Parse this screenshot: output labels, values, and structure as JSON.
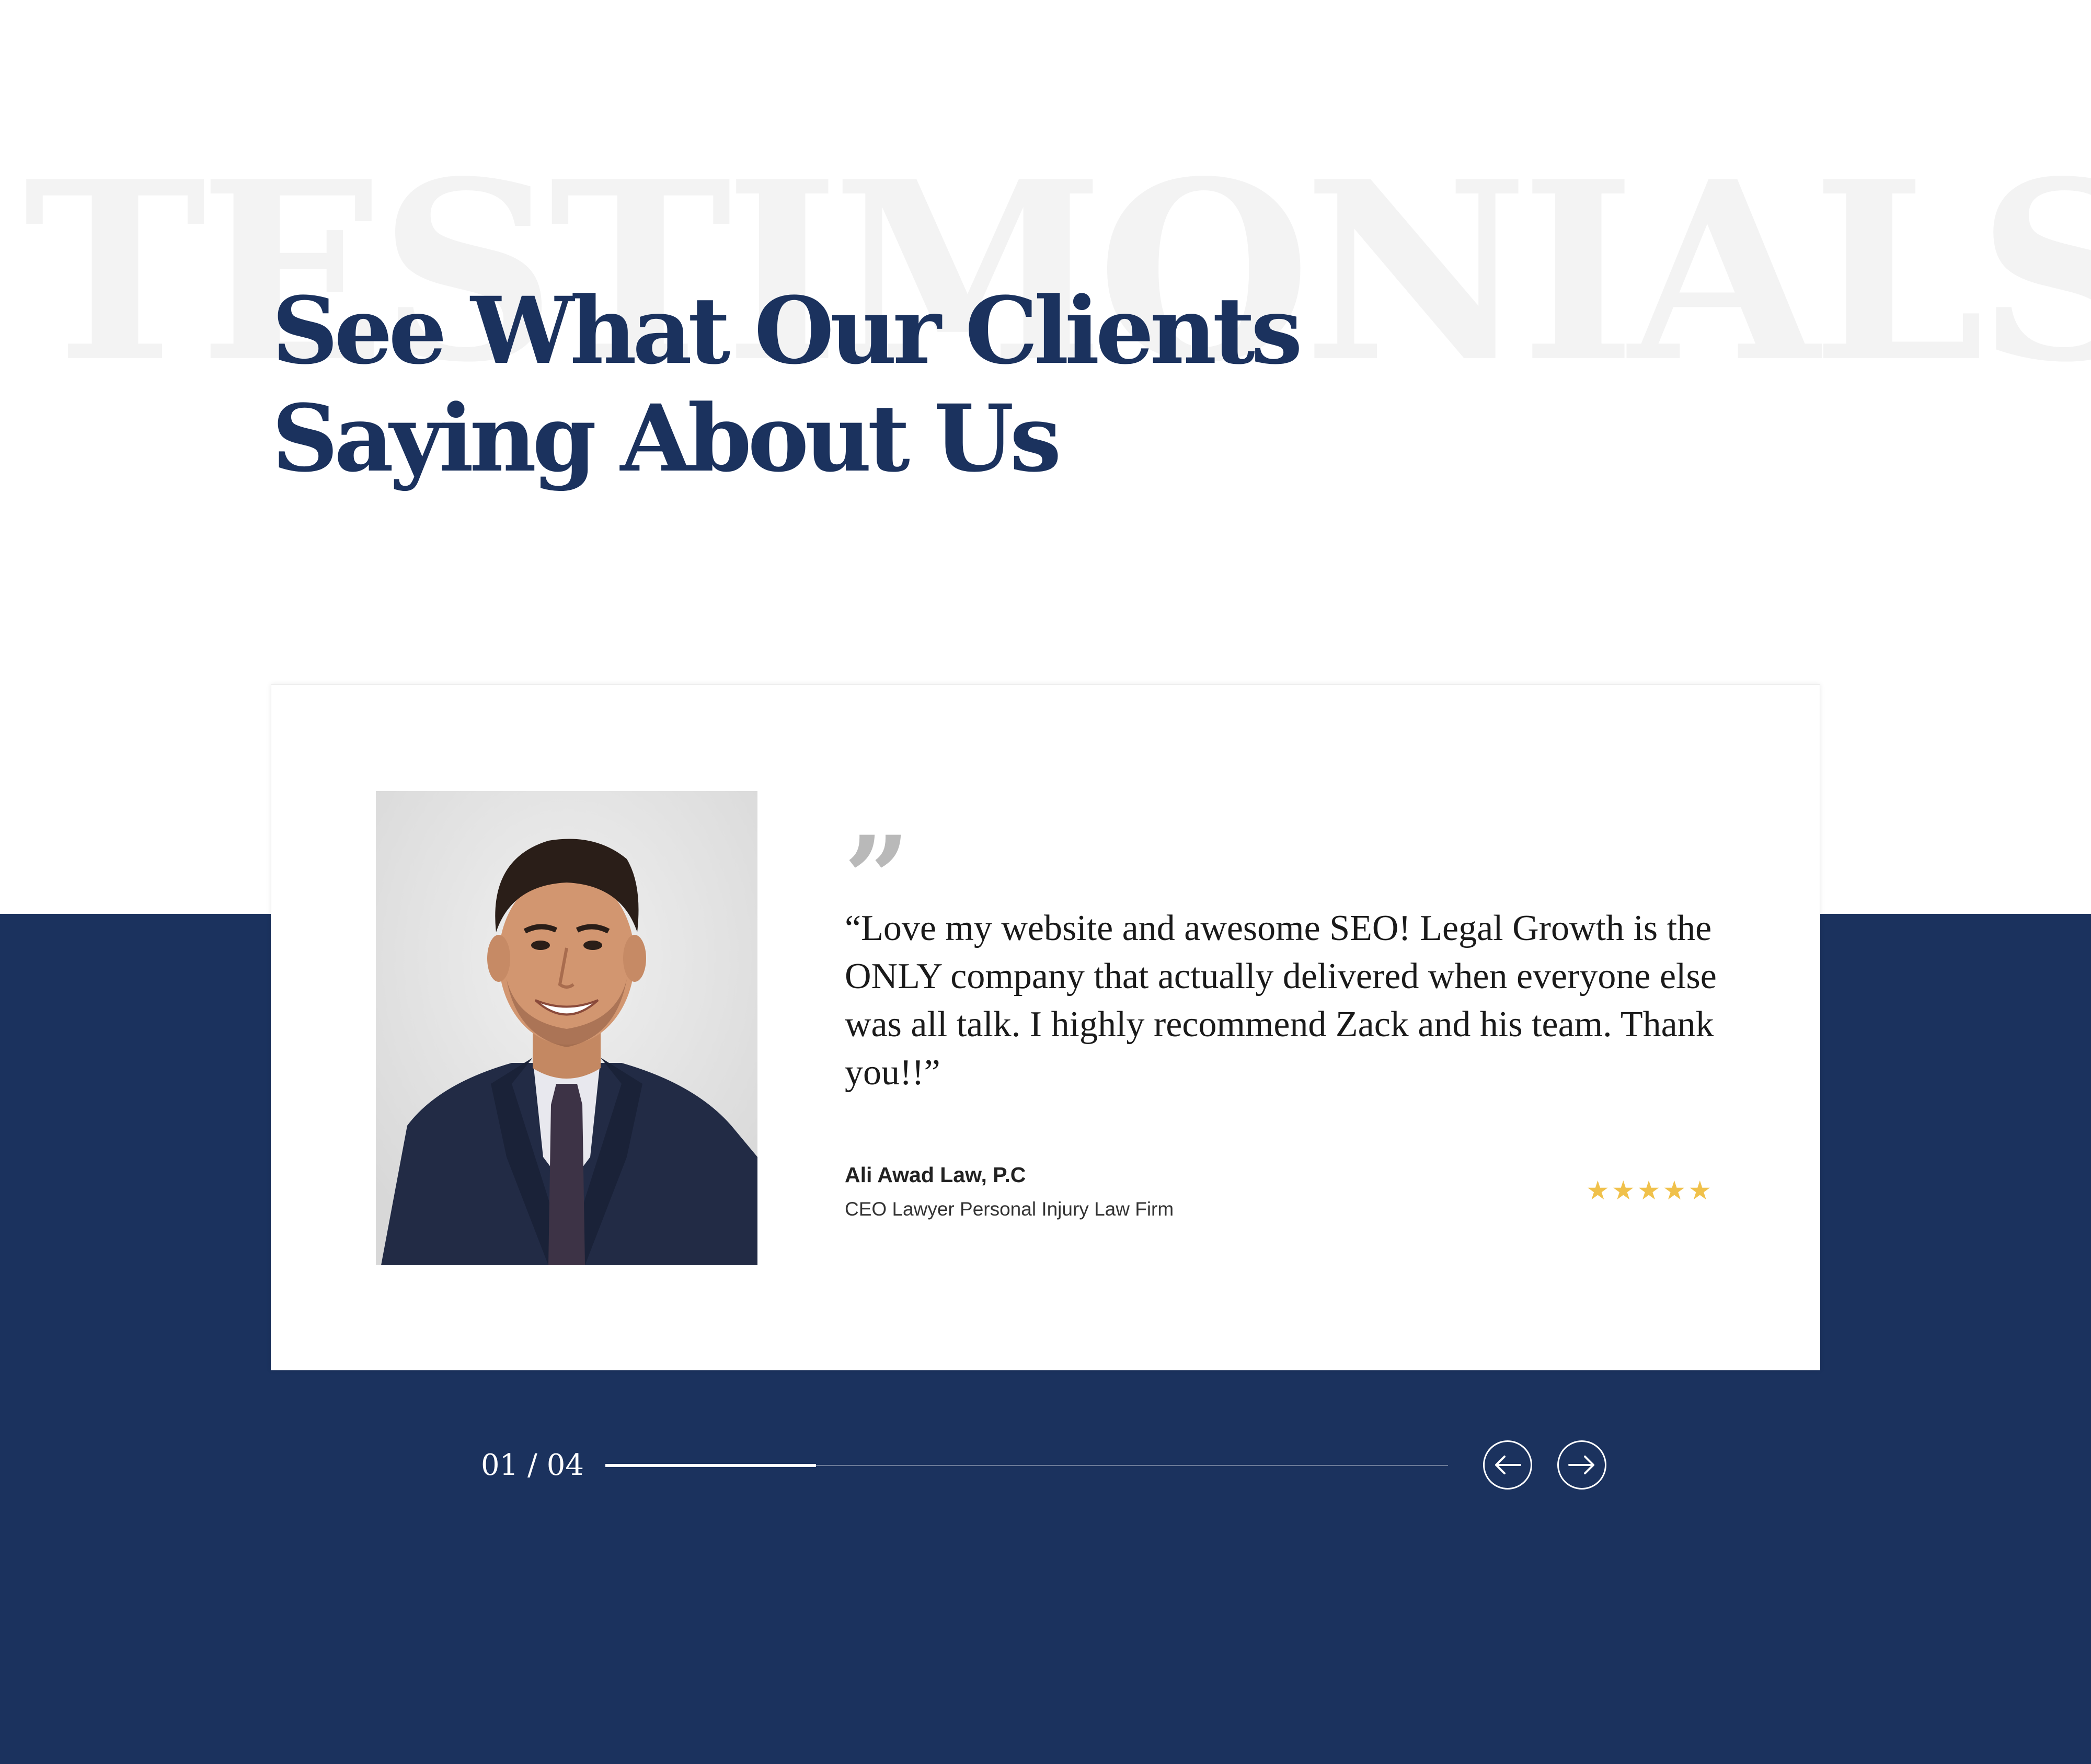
{
  "section": {
    "background_word": "TESTIMONIALS",
    "heading_lines": [
      "See What Our Clients",
      "Saying About Us"
    ]
  },
  "testimonial": {
    "quote_mark": "”",
    "quote": "“Love my website and awesome SEO! Legal Growth is the ONLY company that actually delivered when everyone else was all talk. I highly recommend Zack and his team. Thank you!!”",
    "author_name": "Ali Awad Law, P.C",
    "author_role": "CEO Lawyer Personal Injury Law Firm",
    "rating": 5,
    "rating_max": 5,
    "star_glyph": "★",
    "photo_icon": "portrait-photo"
  },
  "slider": {
    "counter": "01 / 04",
    "current": 1,
    "total": 4,
    "progress": 0.25,
    "prev_icon": "arrow-left-icon",
    "next_icon": "arrow-right-icon"
  },
  "colors": {
    "navy": "#1b325e",
    "star": "#f0c14b",
    "background_word": "#f3f3f3",
    "quote_mark": "#b9b9b9"
  }
}
